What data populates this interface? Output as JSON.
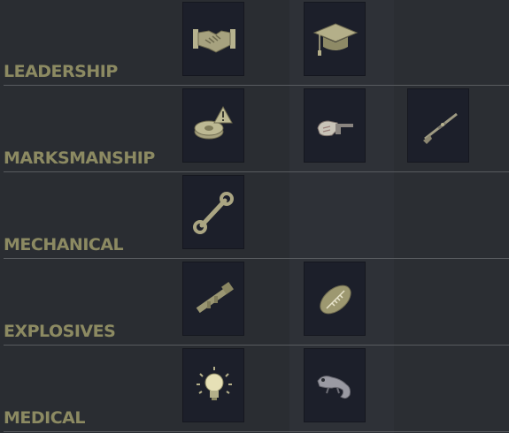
{
  "skills": [
    {
      "label": "LEADERSHIP",
      "perks": [
        "handshake-icon",
        "graduation-cap-icon"
      ]
    },
    {
      "label": "MARKSMANSHIP",
      "perks": [
        "landmine-warning-icon",
        "hand-pistol-icon",
        "rifle-icon"
      ]
    },
    {
      "label": "MECHANICAL",
      "perks": [
        "wrench-icon"
      ]
    },
    {
      "label": "EXPLOSIVES",
      "perks": [
        "rocket-launcher-icon",
        "football-icon"
      ]
    },
    {
      "label": "MEDICAL",
      "perks": [
        "lightbulb-icon",
        "chameleon-icon"
      ]
    }
  ],
  "colors": {
    "background": "#2a2d32",
    "label": "#8c8a62",
    "tile": "#1c1f2a",
    "icon": "#a7a27f"
  }
}
